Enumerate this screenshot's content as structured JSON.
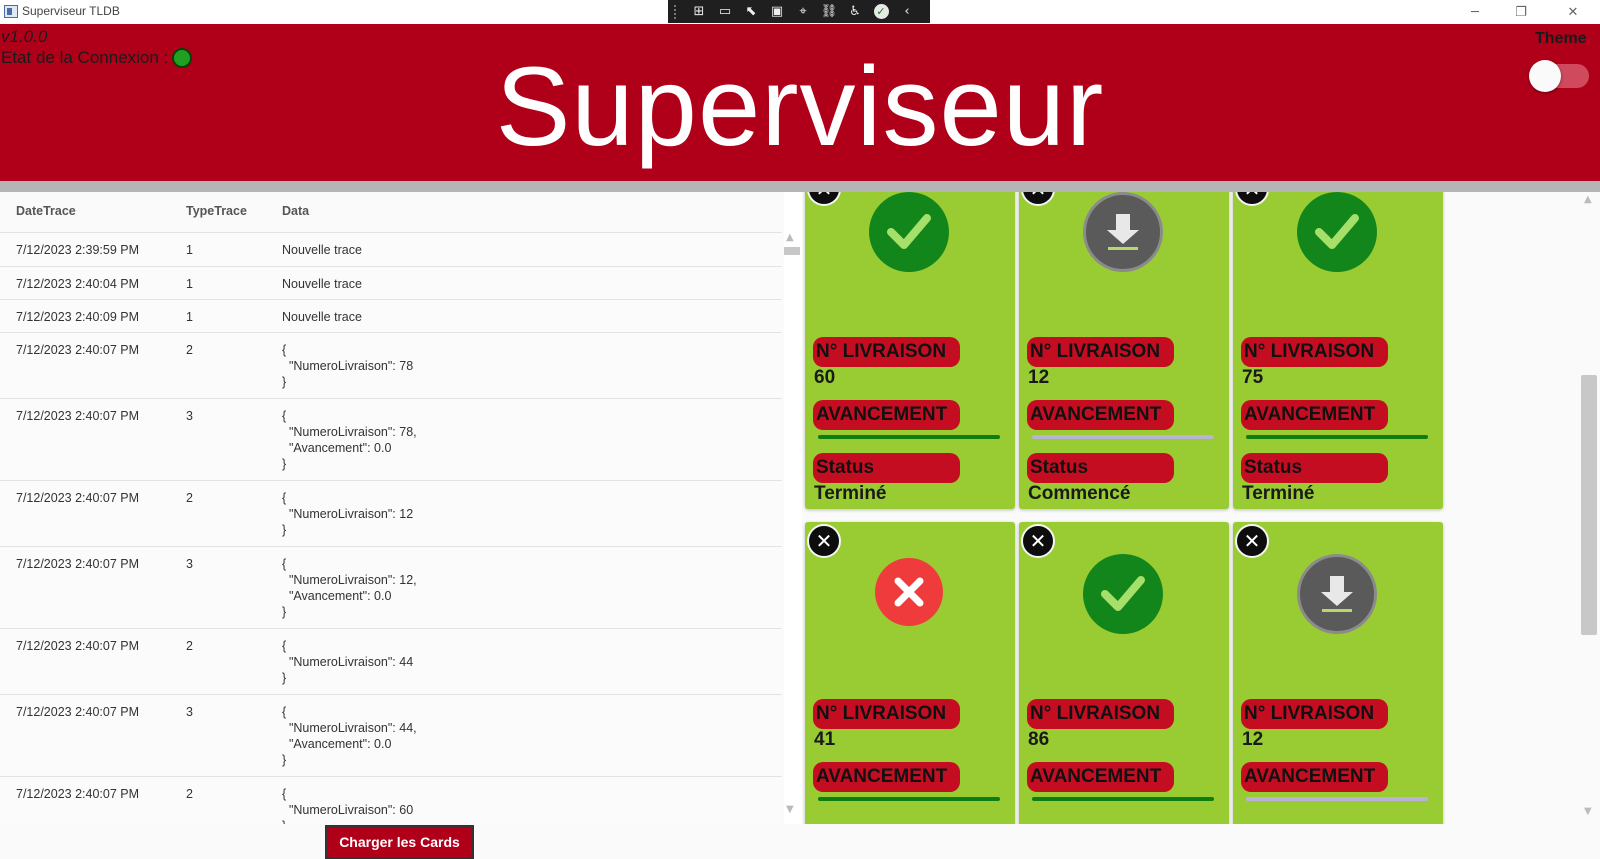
{
  "window": {
    "title": "Superviseur TLDB"
  },
  "header": {
    "version": "v1.0.0",
    "connection_label": "Etat de la Connexion :",
    "title": "Superviseur",
    "theme_label": "Theme",
    "connection_color": "#1fa11f",
    "accent_color": "#b00019"
  },
  "grid": {
    "columns": [
      "DateTrace",
      "TypeTrace",
      "Data"
    ],
    "rows": [
      {
        "date": "7/12/2023 2:39:59 PM",
        "type": "1",
        "data": "Nouvelle trace"
      },
      {
        "date": "7/12/2023 2:40:04 PM",
        "type": "1",
        "data": "Nouvelle trace"
      },
      {
        "date": "7/12/2023 2:40:09 PM",
        "type": "1",
        "data": "Nouvelle trace"
      },
      {
        "date": "7/12/2023 2:40:07 PM",
        "type": "2",
        "data": "{\n  \"NumeroLivraison\": 78\n}"
      },
      {
        "date": "7/12/2023 2:40:07 PM",
        "type": "3",
        "data": "{\n  \"NumeroLivraison\": 78,\n  \"Avancement\": 0.0\n}"
      },
      {
        "date": "7/12/2023 2:40:07 PM",
        "type": "2",
        "data": "{\n  \"NumeroLivraison\": 12\n}"
      },
      {
        "date": "7/12/2023 2:40:07 PM",
        "type": "3",
        "data": "{\n  \"NumeroLivraison\": 12,\n  \"Avancement\": 0.0\n}"
      },
      {
        "date": "7/12/2023 2:40:07 PM",
        "type": "2",
        "data": "{\n  \"NumeroLivraison\": 44\n}"
      },
      {
        "date": "7/12/2023 2:40:07 PM",
        "type": "3",
        "data": "{\n  \"NumeroLivraison\": 44,\n  \"Avancement\": 0.0\n}"
      },
      {
        "date": "7/12/2023 2:40:07 PM",
        "type": "2",
        "data": "{\n  \"NumeroLivraison\": 60\n}"
      }
    ]
  },
  "load_button": "Charger les Cards",
  "card_labels": {
    "delivery": "N° LIVRAISON",
    "progress": "AVANCEMENT",
    "status": "Status"
  },
  "cards": [
    {
      "icon": "check-icon",
      "numero": "60",
      "status": "Terminé",
      "progress": 1.0
    },
    {
      "icon": "download-icon",
      "numero": "12",
      "status": "Commencé",
      "progress": 0.0
    },
    {
      "icon": "check-icon",
      "numero": "75",
      "status": "Terminé",
      "progress": 1.0
    },
    {
      "icon": "error-icon",
      "numero": "41",
      "status": "",
      "progress": 1.0
    },
    {
      "icon": "check-icon",
      "numero": "86",
      "status": "",
      "progress": 1.0
    },
    {
      "icon": "download-icon",
      "numero": "12",
      "status": "",
      "progress": 0.0
    }
  ]
}
